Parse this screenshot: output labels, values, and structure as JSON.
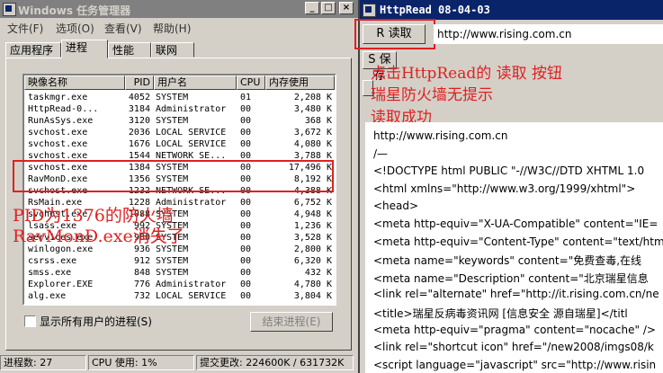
{
  "task_manager": {
    "title": "Windows 任务管理器",
    "menu": [
      "文件(F)",
      "选项(O)",
      "查看(V)",
      "帮助(H)"
    ],
    "tabs": [
      "应用程序",
      "进程",
      "性能",
      "联网"
    ],
    "columns": [
      "映像名称",
      "PID",
      "用户名",
      "CPU",
      "内存使用"
    ],
    "rows": [
      {
        "name": "taskmgr.exe",
        "pid": "4052",
        "user": "SYSTEM",
        "cpu": "01",
        "mem": "2,208 K"
      },
      {
        "name": "HttpRead-0...",
        "pid": "3184",
        "user": "Administrator",
        "cpu": "00",
        "mem": "3,480 K"
      },
      {
        "name": "RunAsSys.exe",
        "pid": "3120",
        "user": "SYSTEM",
        "cpu": "00",
        "mem": "368 K"
      },
      {
        "name": "svchost.exe",
        "pid": "2036",
        "user": "LOCAL SERVICE",
        "cpu": "00",
        "mem": "3,672 K"
      },
      {
        "name": "svchost.exe",
        "pid": "1676",
        "user": "LOCAL SERVICE",
        "cpu": "00",
        "mem": "4,080 K"
      },
      {
        "name": "svchost.exe",
        "pid": "1544",
        "user": "NETWORK SE...",
        "cpu": "00",
        "mem": "3,788 K"
      },
      {
        "name": "svchost.exe",
        "pid": "1384",
        "user": "SYSTEM",
        "cpu": "00",
        "mem": "17,496 K"
      },
      {
        "name": "RavMonD.exe",
        "pid": "1356",
        "user": "SYSTEM",
        "cpu": "00",
        "mem": "8,192 K"
      },
      {
        "name": "svchost.exe",
        "pid": "1232",
        "user": "NETWORK SE...",
        "cpu": "00",
        "mem": "4,388 K"
      },
      {
        "name": "RsMain.exe",
        "pid": "1228",
        "user": "Administrator",
        "cpu": "00",
        "mem": "6,752 K"
      },
      {
        "name": "svchost.exe",
        "pid": "1088",
        "user": "SYSTEM",
        "cpu": "00",
        "mem": "4,948 K"
      },
      {
        "name": "lsass.exe",
        "pid": "992",
        "user": "SYSTEM",
        "cpu": "00",
        "mem": "1,236 K"
      },
      {
        "name": "services.exe",
        "pid": "980",
        "user": "SYSTEM",
        "cpu": "00",
        "mem": "3,528 K"
      },
      {
        "name": "winlogon.exe",
        "pid": "936",
        "user": "SYSTEM",
        "cpu": "00",
        "mem": "2,800 K"
      },
      {
        "name": "csrss.exe",
        "pid": "912",
        "user": "SYSTEM",
        "cpu": "00",
        "mem": "6,320 K"
      },
      {
        "name": "smss.exe",
        "pid": "848",
        "user": "SYSTEM",
        "cpu": "00",
        "mem": "432 K"
      },
      {
        "name": "Explorer.EXE",
        "pid": "776",
        "user": "Administrator",
        "cpu": "00",
        "mem": "4,780 K"
      },
      {
        "name": "alg.exe",
        "pid": "732",
        "user": "LOCAL SERVICE",
        "cpu": "00",
        "mem": "3,804 K"
      }
    ],
    "show_all_users": "显示所有用户的进程(S)",
    "end_process": "结束进程(E)",
    "status": {
      "processes": "进程数: 27",
      "cpu": "CPU 使用: 1%",
      "commit": "提交更改: 224600K / 631732K"
    }
  },
  "httpread": {
    "title": "HttpRead 08-04-03",
    "read_button": "R 读取",
    "save_button": "S 保存",
    "url": "http://www.rising.com.cn",
    "content_lines": [
      "http://www.rising.com.cn",
      "/—",
      "<!DOCTYPE html PUBLIC \"-//W3C//DTD XHTML 1.0",
      "<html xmlns=\"http://www.w3.org/1999/xhtml\">",
      "<head>",
      "<meta http-equiv=\"X-UA-Compatible\" content=\"IE=",
      "<meta http-equiv=\"Content-Type\" content=\"text/htm",
      "<meta name=\"keywords\" content=\"免费查毒,在线",
      "<meta name=\"Description\" content=\"北京瑞星信息",
      "<link rel=\"alternate\" href=\"http://it.rising.com.cn/ne",
      "<title>瑞星反病毒资讯网 [信息安全 源自瑞星]</titl",
      "<meta http-equiv=\"pragma\" content=\"nocache\" />",
      "<link rel=\"shortcut icon\" href=\"/new2008/imgs08/k",
      "<script language=\"javascript\" src=\"http://www.risin"
    ]
  },
  "annotations": {
    "right_line1": "点击HttpRead的 读取 按钮",
    "right_line2": "瑞星防火墙无提示",
    "right_line3": "读取成功",
    "left_line1": "PID为1376的防火墙",
    "left_line2": "RavMonD.exe消失了"
  },
  "colors": {
    "annotation": "#e02020",
    "titlebar_active": "#0a246a",
    "titlebar_inactive": "#808080"
  }
}
